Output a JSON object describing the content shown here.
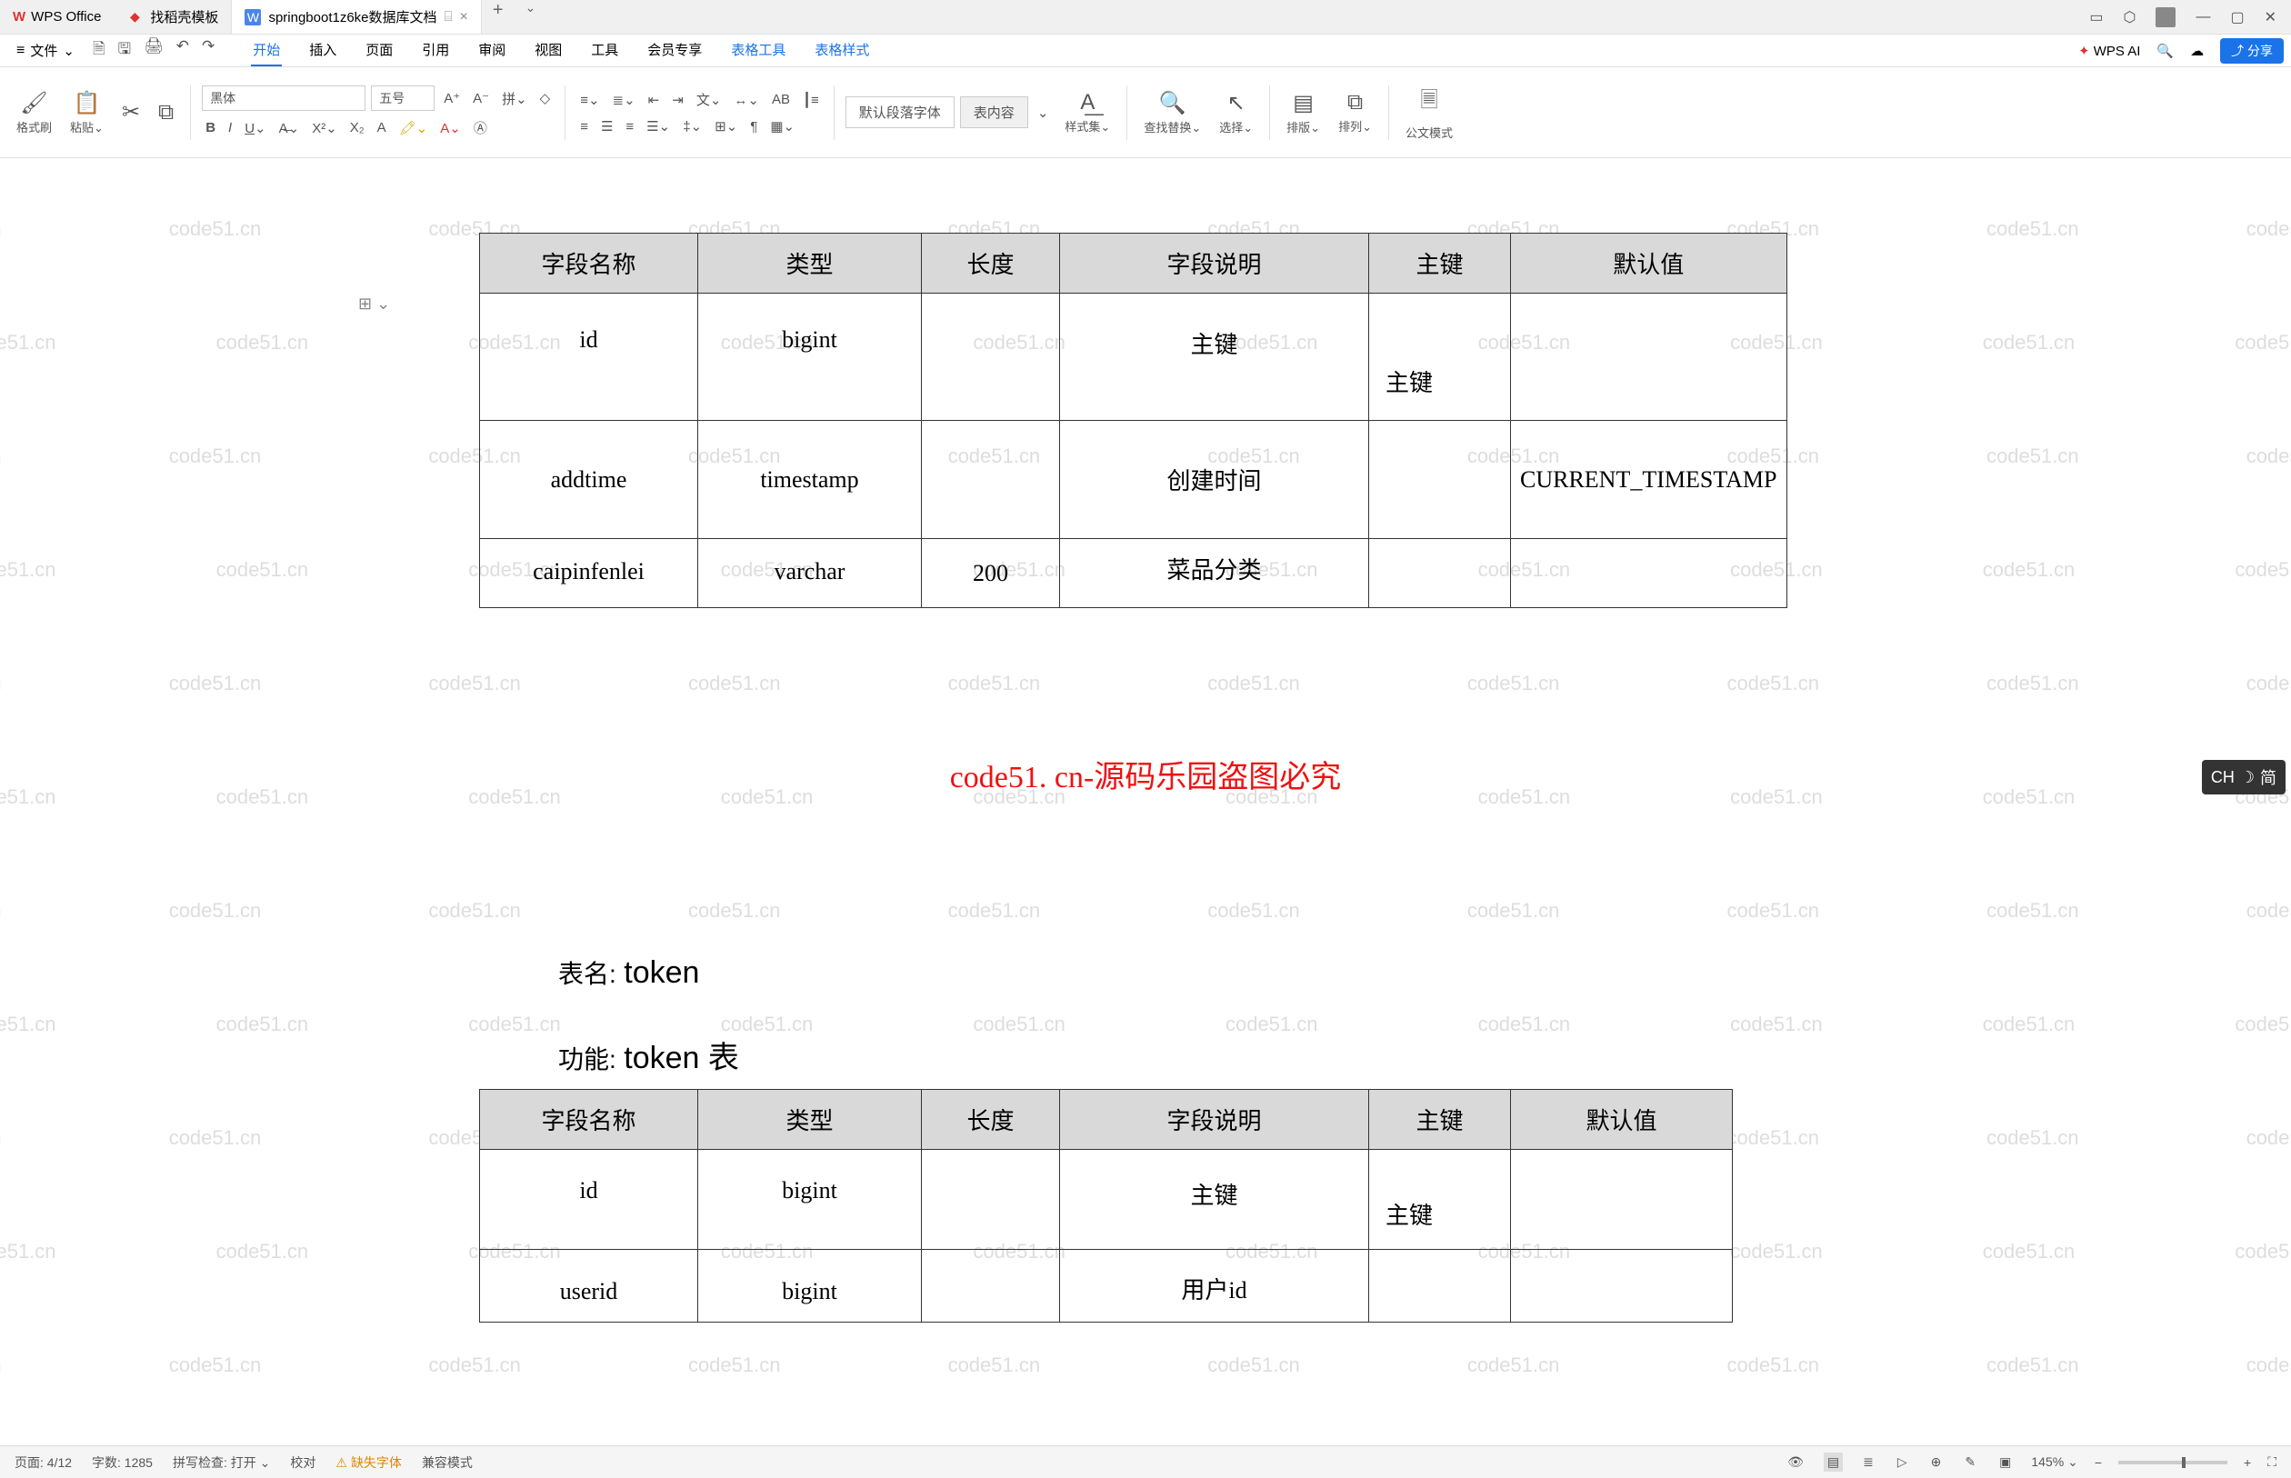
{
  "titlebar": {
    "app_name": "WPS Office",
    "tabs": [
      {
        "label": "找稻壳模板",
        "type": "red"
      },
      {
        "label": "springboot1z6ke数据库文档",
        "type": "doc",
        "active": true
      }
    ]
  },
  "menubar": {
    "file": "文件",
    "menus": [
      "开始",
      "插入",
      "页面",
      "引用",
      "审阅",
      "视图",
      "工具",
      "会员专享",
      "表格工具",
      "表格样式"
    ],
    "active_index": 0,
    "table_start_index": 8,
    "wps_ai": "WPS AI",
    "share": "分享"
  },
  "ribbon": {
    "format_painter": "格式刷",
    "paste": "粘贴",
    "font_name": "黑体",
    "font_size": "五号",
    "para_style_default": "默认段落字体",
    "para_style_content": "表内容",
    "style_set": "样式集",
    "find_replace": "查找替换",
    "select": "选择",
    "layout": "排版",
    "arrange": "排列",
    "gov_mode": "公文模式"
  },
  "document": {
    "watermark_text": "code51.cn",
    "red_banner": "code51. cn-源码乐园盗图必究",
    "table1": {
      "headers": [
        "字段名称",
        "类型",
        "长度",
        "字段说明",
        "主键",
        "默认值"
      ],
      "rows": [
        {
          "name": "id",
          "type": "bigint",
          "len": "",
          "desc": "主键",
          "pk": "主键",
          "def": ""
        },
        {
          "name": "addtime",
          "type": "timestamp",
          "len": "",
          "desc": "创建时间",
          "pk": "",
          "def": "CURRENT_TIMESTAMP"
        },
        {
          "name": "caipinfenlei",
          "type": "varchar",
          "len": "200",
          "desc": "菜品分类",
          "pk": "",
          "def": ""
        }
      ]
    },
    "caption2_name_label": "表名:",
    "caption2_name": "token",
    "caption2_func_label": "功能:",
    "caption2_func": "token 表",
    "table2": {
      "headers": [
        "字段名称",
        "类型",
        "长度",
        "字段说明",
        "主键",
        "默认值"
      ],
      "rows": [
        {
          "name": "id",
          "type": "bigint",
          "len": "",
          "desc": "主键",
          "pk": "主键",
          "def": ""
        },
        {
          "name": "userid",
          "type": "bigint",
          "len": "",
          "desc": "用户id",
          "pk": "",
          "def": ""
        }
      ]
    }
  },
  "statusbar": {
    "page": "页面: 4/12",
    "words": "字数: 1285",
    "spellcheck": "拼写检查: 打开",
    "proofread": "校对",
    "missing_font": "缺失字体",
    "compat": "兼容模式",
    "zoom": "145%"
  },
  "ime": {
    "label": "CH",
    "mode": "简"
  }
}
